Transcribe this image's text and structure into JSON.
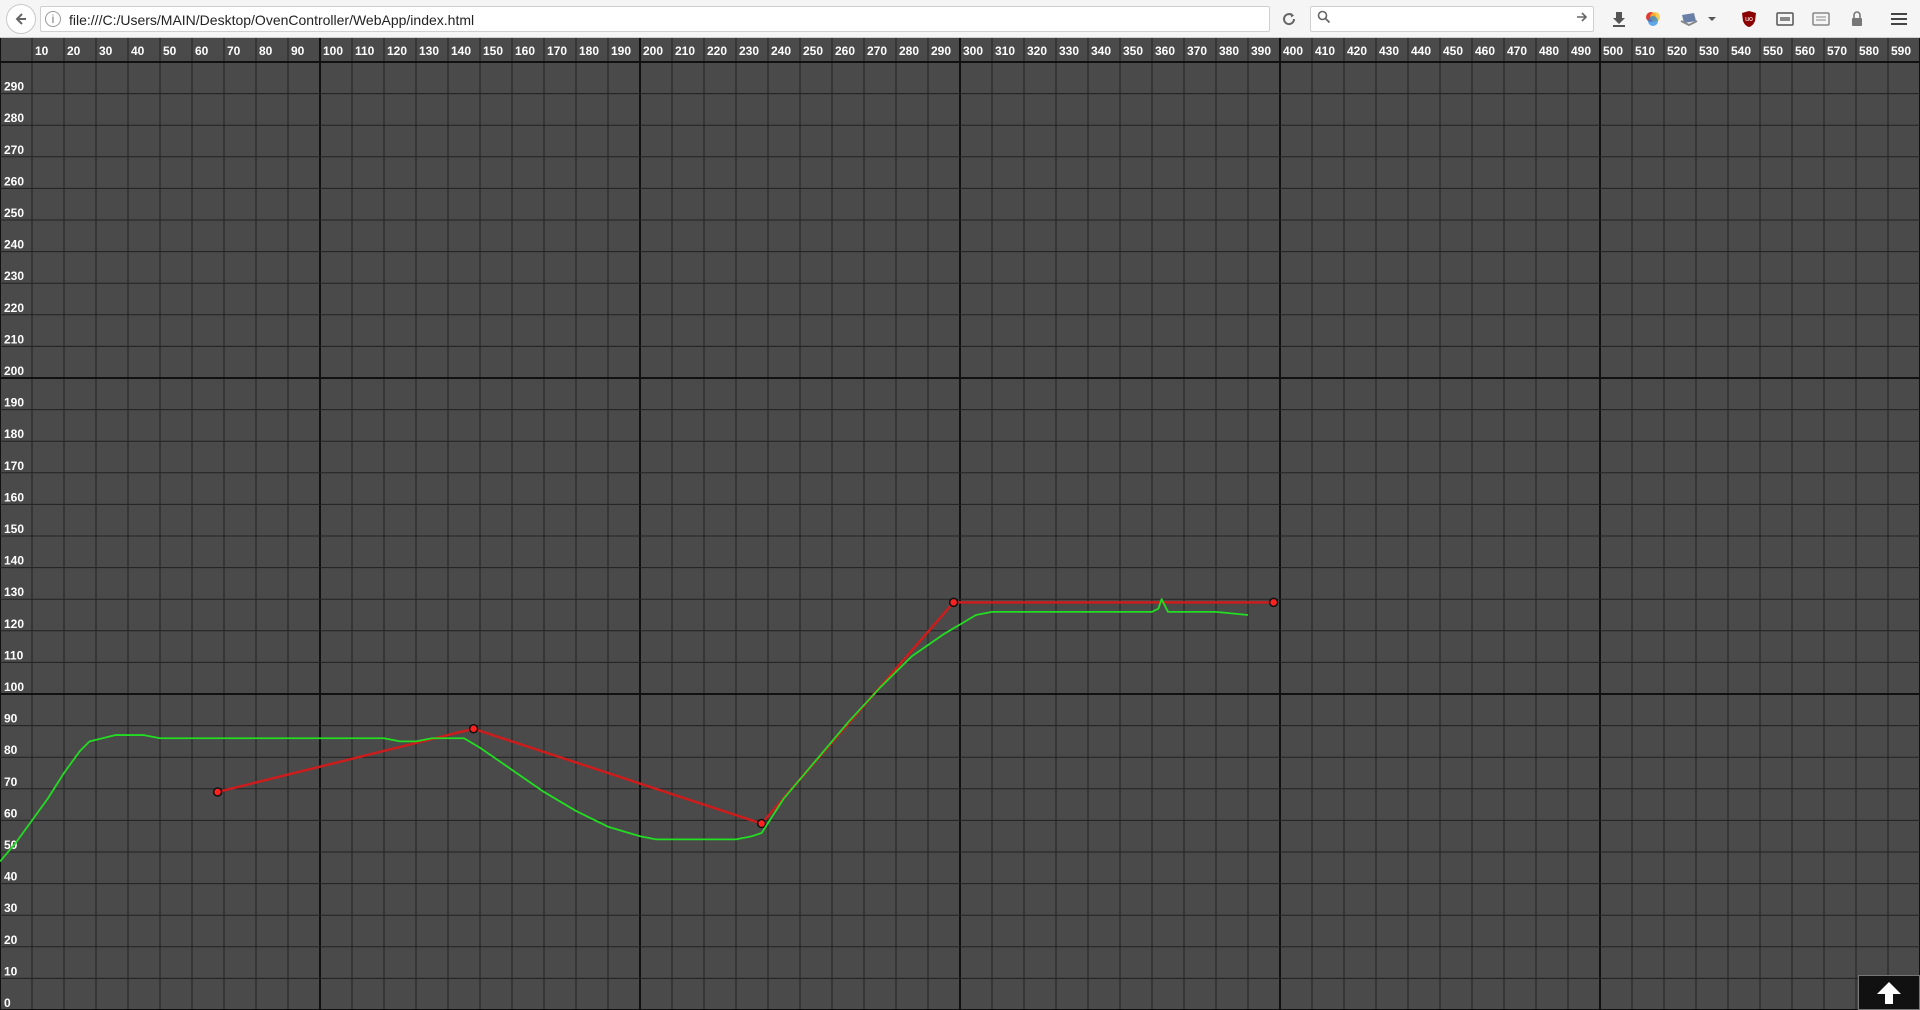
{
  "browser": {
    "url": "file:///C:/Users/MAIN/Desktop/OvenController/WebApp/index.html",
    "search_placeholder": "",
    "icons": [
      "back-arrow-icon",
      "info-icon",
      "reload-icon",
      "search-icon",
      "arrow-right-icon",
      "download-icon",
      "color-extension-icon",
      "pocket-icon",
      "dropdown-icon",
      "ublock-icon",
      "extension-icon",
      "extension-icon",
      "lock-icon",
      "hamburger-menu-icon"
    ]
  },
  "chart_data": {
    "type": "line",
    "title": "",
    "xlabel": "",
    "ylabel": "",
    "xlim": [
      0,
      600
    ],
    "ylim": [
      0,
      300
    ],
    "x_ticks": [
      10,
      20,
      30,
      40,
      50,
      60,
      70,
      80,
      90,
      100,
      110,
      120,
      130,
      140,
      150,
      160,
      170,
      180,
      190,
      200,
      210,
      220,
      230,
      240,
      250,
      260,
      270,
      280,
      290,
      300,
      310,
      320,
      330,
      340,
      350,
      360,
      370,
      380,
      390,
      400,
      410,
      420,
      430,
      440,
      450,
      460,
      470,
      480,
      490,
      500,
      510,
      520,
      530,
      540,
      550,
      560,
      570,
      580,
      590
    ],
    "y_ticks": [
      290,
      280,
      270,
      260,
      250,
      240,
      230,
      220,
      210,
      200,
      190,
      180,
      170,
      160,
      150,
      140,
      130,
      120,
      110,
      100,
      90,
      80,
      70,
      60,
      50,
      40,
      30,
      20,
      10,
      0
    ],
    "grid": true,
    "series": [
      {
        "color": "#cc1c1c",
        "marker": "circle",
        "x": [
          68,
          148,
          238,
          298,
          398
        ],
        "y": [
          69,
          89,
          59,
          129,
          129
        ]
      },
      {
        "color": "#22dd22",
        "marker": "none",
        "x": [
          0,
          5,
          10,
          15,
          20,
          25,
          28,
          32,
          36,
          40,
          45,
          50,
          55,
          60,
          70,
          80,
          90,
          100,
          110,
          120,
          125,
          130,
          135,
          140,
          145,
          150,
          160,
          170,
          180,
          190,
          200,
          205,
          210,
          215,
          220,
          225,
          230,
          235,
          238,
          245,
          255,
          265,
          275,
          285,
          295,
          300,
          305,
          310,
          315,
          320,
          330,
          340,
          350,
          355,
          360,
          362,
          363,
          365,
          370,
          380,
          390
        ],
        "y": [
          47,
          53,
          60,
          67,
          75,
          82,
          85,
          86,
          87,
          87,
          87,
          86,
          86,
          86,
          86,
          86,
          86,
          86,
          86,
          86,
          85,
          85,
          86,
          86,
          86,
          83,
          76,
          69,
          63,
          58,
          55,
          54,
          54,
          54,
          54,
          54,
          54,
          55,
          56,
          67,
          79,
          91,
          102,
          112,
          119,
          122,
          125,
          126,
          126,
          126,
          126,
          126,
          126,
          126,
          126,
          127,
          130,
          126,
          126,
          126,
          125
        ]
      }
    ]
  }
}
